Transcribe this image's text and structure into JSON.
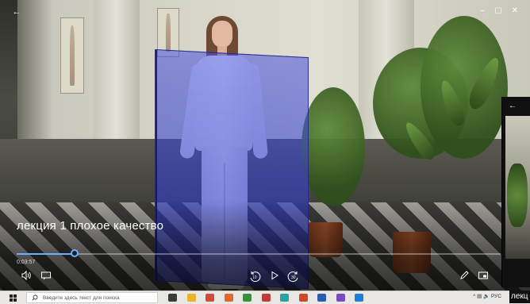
{
  "window": {
    "back_glyph": "←",
    "minimize_glyph": "–",
    "restore_glyph": "▢",
    "close_glyph": "✕"
  },
  "media": {
    "title": "лекция  1 плохое качество",
    "elapsed": "0:03:57",
    "progress_fraction": 0.12,
    "accent_color": "#6ab2ff"
  },
  "controls": {
    "volume_icon": "volume-icon",
    "subtitles_icon": "subtitles-icon",
    "rewind_icon": "rewind-10-icon",
    "play_icon": "play-icon",
    "forward_icon": "forward-30-icon",
    "edit_icon": "pen-icon",
    "miniview_icon": "miniview-icon",
    "rewind_label": "10",
    "forward_label": "30"
  },
  "taskbar": {
    "search_placeholder": "Введите здесь текст для поиска",
    "language": "РУС",
    "tray_chevron": "^",
    "apps": [
      {
        "name": "task-view-icon",
        "color": "#3a3a3a"
      },
      {
        "name": "file-explorer-icon",
        "color": "#e8b42a"
      },
      {
        "name": "mail-icon",
        "color": "#d24a3b"
      },
      {
        "name": "app-orange-icon",
        "color": "#e3662a"
      },
      {
        "name": "chrome-icon",
        "color": "#3a8f3f"
      },
      {
        "name": "app-red-icon",
        "color": "#c43a3a"
      },
      {
        "name": "app-teal-icon",
        "color": "#2aa2a0"
      },
      {
        "name": "powerpoint-icon",
        "color": "#d04a2a"
      },
      {
        "name": "word-icon",
        "color": "#2b5cad"
      },
      {
        "name": "app-purple-icon",
        "color": "#7a4bbd"
      },
      {
        "name": "movies-tv-icon",
        "color": "#1f7fd6"
      }
    ]
  },
  "second_window": {
    "back_glyph": "←",
    "clipped_title": "лекц"
  }
}
